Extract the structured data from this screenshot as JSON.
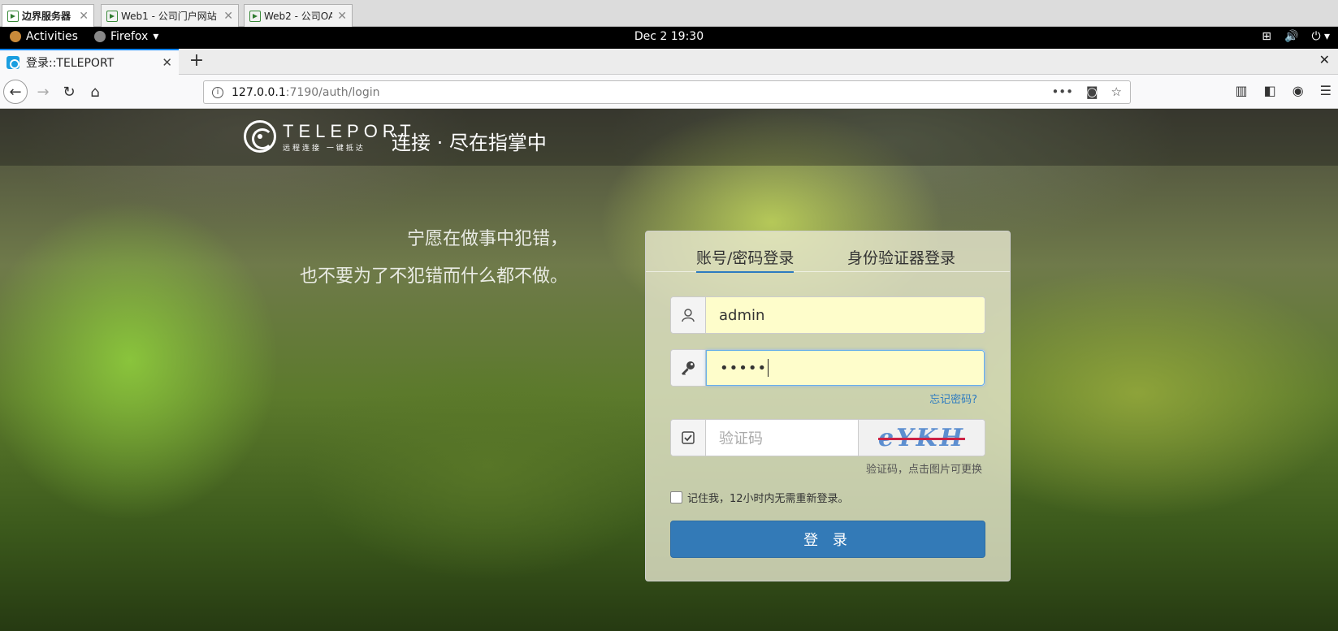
{
  "host_tabs": [
    {
      "label": "边界服务器"
    },
    {
      "label": "Web1 - 公司门户网站"
    },
    {
      "label": "Web2 - 公司OA"
    }
  ],
  "gnome": {
    "activities": "Activities",
    "app_menu": "Firefox",
    "clock": "Dec 2  19:30"
  },
  "browser": {
    "tab_title": "登录::TELEPORT",
    "url_host": "127.0.0.1",
    "url_path": ":7190/auth/login"
  },
  "brand": {
    "logo_big": "TELEPORT",
    "logo_small": "远程连接 一键抵达",
    "slogan": "连接 · 尽在指掌中"
  },
  "quote": {
    "line1": "宁愿在做事中犯错，",
    "line2": "也不要为了不犯错而什么都不做。"
  },
  "login": {
    "tab_password": "账号/密码登录",
    "tab_authenticator": "身份验证器登录",
    "username_value": "admin",
    "password_mask": "•••••",
    "forgot": "忘记密码?",
    "captcha_placeholder": "验证码",
    "captcha_image_text": "eYKH",
    "captcha_hint": "验证码，点击图片可更换",
    "remember": "记住我，12小时内无需重新登录。",
    "submit": "登 录"
  }
}
